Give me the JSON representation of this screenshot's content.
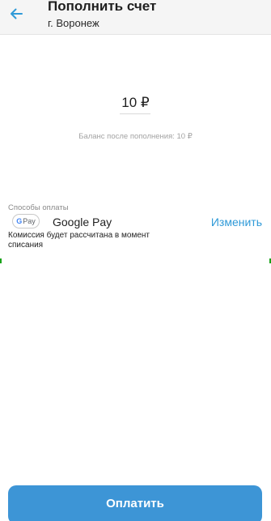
{
  "header": {
    "title": "Пополнить счет",
    "subtitle": "г. Воронеж",
    "back_icon": "arrow-left-icon"
  },
  "amount": {
    "value": "10 ₽"
  },
  "balance": {
    "note": "Баланс после пополнения: 10 ₽"
  },
  "payment": {
    "section_label": "Способы оплаты",
    "badge_g": "G",
    "badge_pay": "Pay",
    "method_name": "Google Pay",
    "change_label": "Изменить",
    "commission_note": "Комиссия будет рассчитана в момент списания"
  },
  "footer": {
    "pay_label": "Оплатить"
  },
  "colors": {
    "accent": "#2f9ad8",
    "button": "#3d95d6",
    "header_bg": "#f5f5f5"
  }
}
